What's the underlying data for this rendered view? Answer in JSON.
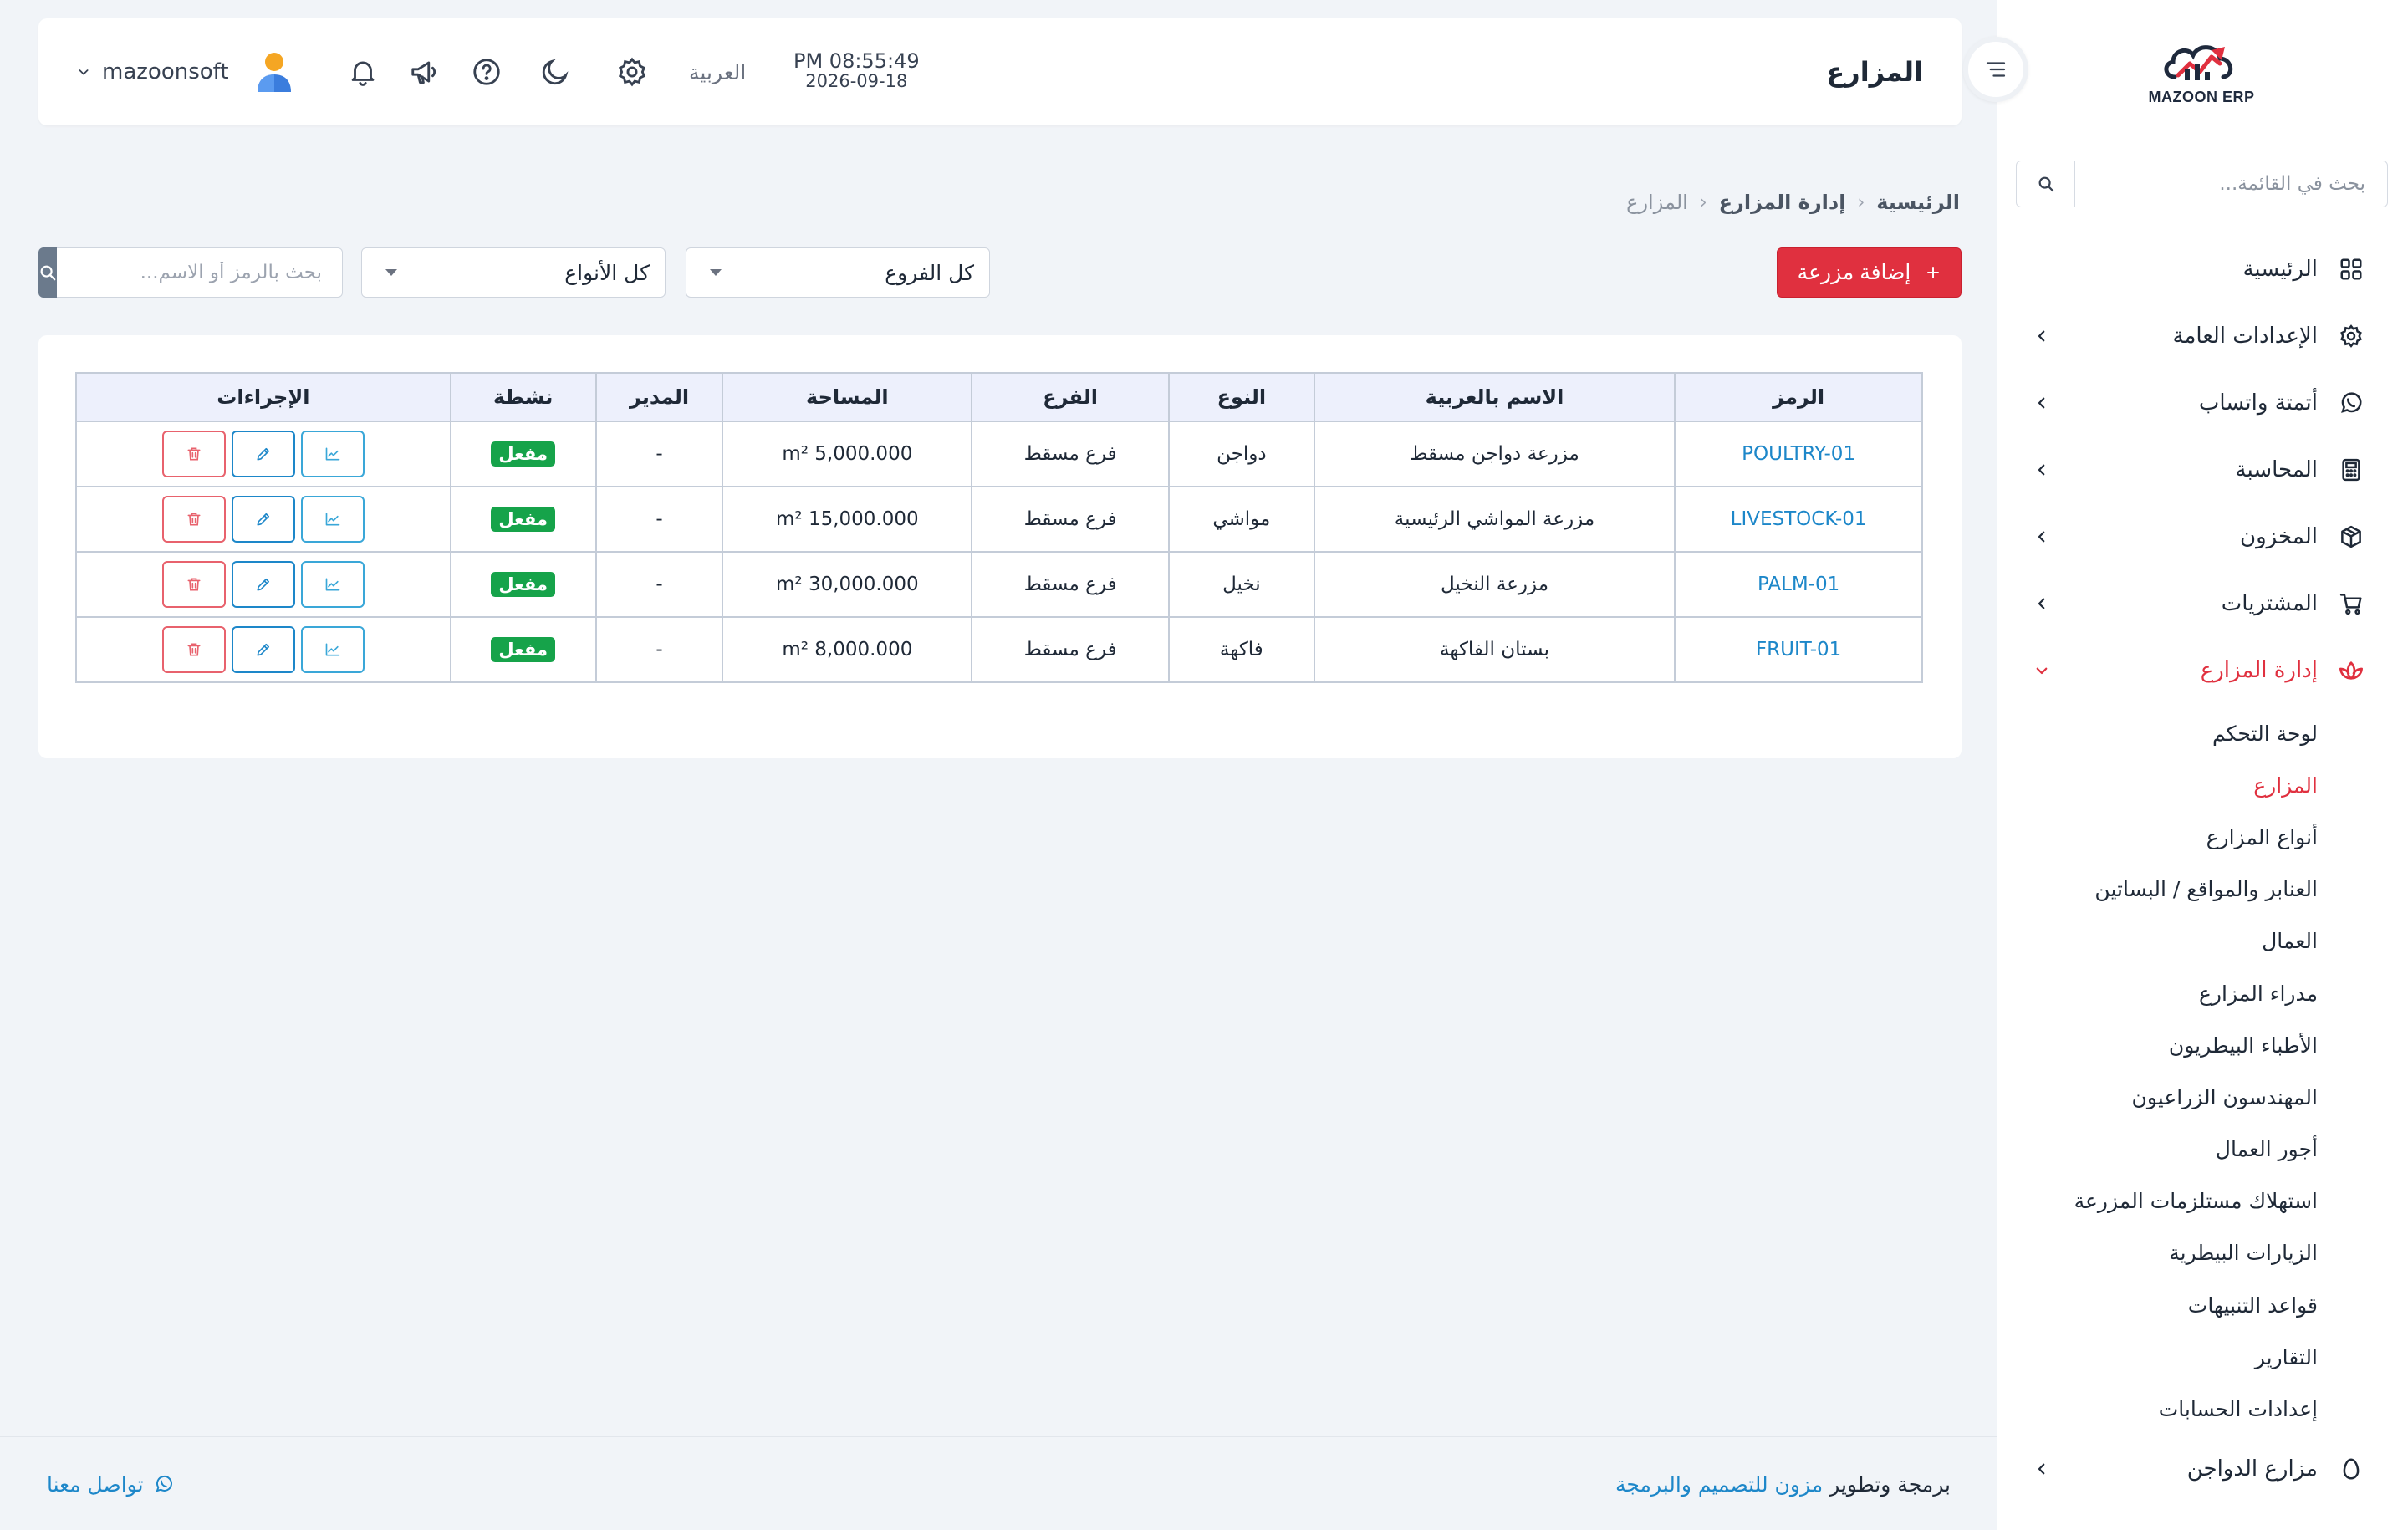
{
  "brand": {
    "logo_text": "MAZOON ERP",
    "logo_subtext": "ERP",
    "colors": {
      "accent": "#e0303f",
      "link": "#1d87c9",
      "active_badge": "#16a34a"
    }
  },
  "sidebar": {
    "search_placeholder": "بحث في القائمة...",
    "items": [
      {
        "label": "الرئيسية",
        "icon": "grid-icon"
      },
      {
        "label": "الإعدادات العامة",
        "icon": "gear-icon"
      },
      {
        "label": "أتمتة واتساب",
        "icon": "whatsapp-icon"
      },
      {
        "label": "المحاسبة",
        "icon": "calculator-icon"
      },
      {
        "label": "المخزون",
        "icon": "box-icon"
      },
      {
        "label": "المشتريات",
        "icon": "cart-icon"
      },
      {
        "label": "إدارة المزارع",
        "icon": "lotus-icon"
      },
      {
        "label": "مزارع الدواجن",
        "icon": "egg-icon"
      }
    ],
    "submenu": [
      "لوحة التحكم",
      "المزارع",
      "أنواع المزارع",
      "العنابر والمواقع / البساتين",
      "العمال",
      "مدراء المزارع",
      "الأطباء البيطريون",
      "المهندسون الزراعيون",
      "أجور العمال",
      "استهلاك مستلزمات المزرعة",
      "الزيارات البيطرية",
      "قواعد التنبيهات",
      "التقارير",
      "إعدادات الحسابات"
    ],
    "active_submenu": "المزارع"
  },
  "header": {
    "title": "المزارع",
    "time": "PM 08:55:49",
    "date": "2026-09-18",
    "language": "العربية",
    "username": "mazoonsoft"
  },
  "breadcrumb": [
    "الرئيسية",
    "إدارة المزارع",
    "المزارع"
  ],
  "toolbar": {
    "add_label": "إضافة مزرعة",
    "branch_select": "كل الفروع",
    "type_select": "كل الأنواع",
    "search_placeholder": "بحث بالرمز أو الاسم..."
  },
  "table": {
    "headers": [
      "الرمز",
      "الاسم بالعربية",
      "النوع",
      "الفرع",
      "المساحة",
      "المدير",
      "نشطة",
      "الإجراءات"
    ],
    "rows": [
      {
        "code": "POULTRY-01",
        "name": "مزرعة دواجن مسقط",
        "type": "دواجن",
        "branch": "فرع مسقط",
        "area": "5,000.000 m²",
        "manager": "-",
        "active": "مفعل"
      },
      {
        "code": "LIVESTOCK-01",
        "name": "مزرعة المواشي الرئيسية",
        "type": "مواشي",
        "branch": "فرع مسقط",
        "area": "15,000.000 m²",
        "manager": "-",
        "active": "مفعل"
      },
      {
        "code": "PALM-01",
        "name": "مزرعة النخيل",
        "type": "نخيل",
        "branch": "فرع مسقط",
        "area": "30,000.000 m²",
        "manager": "-",
        "active": "مفعل"
      },
      {
        "code": "FRUIT-01",
        "name": "بستان الفاكهة",
        "type": "فاكهة",
        "branch": "فرع مسقط",
        "area": "8,000.000 m²",
        "manager": "-",
        "active": "مفعل"
      }
    ]
  },
  "footer": {
    "credit_prefix": "برمجة وتطوير",
    "credit_link": "مزون للتصميم والبرمجة",
    "contact": "تواصل معنا"
  }
}
